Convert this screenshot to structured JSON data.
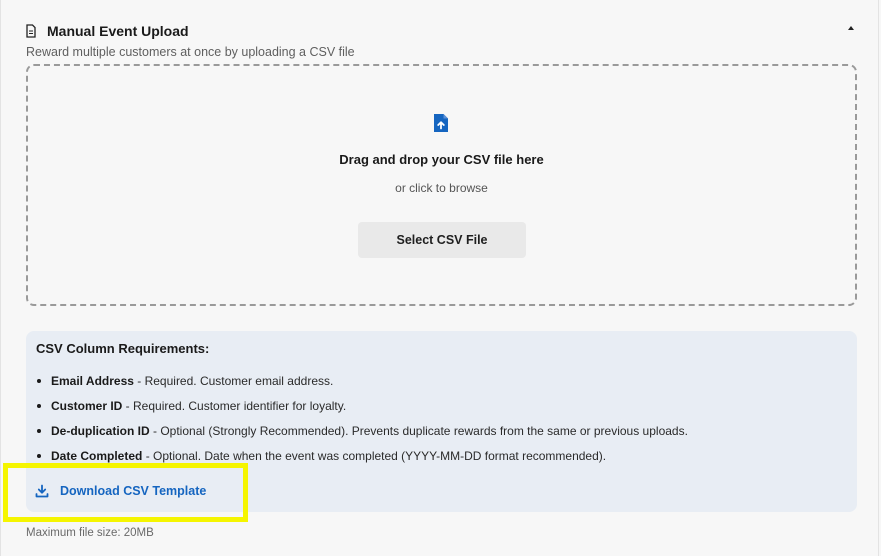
{
  "header": {
    "title": "Manual Event Upload",
    "subtitle": "Reward multiple customers at once by uploading a CSV file"
  },
  "dropzone": {
    "title": "Drag and drop your CSV file here",
    "subtitle": "or click to browse",
    "button_label": "Select CSV File"
  },
  "requirements": {
    "title": "CSV Column Requirements:",
    "items": [
      {
        "name": "Email Address",
        "desc": " - Required. Customer email address."
      },
      {
        "name": "Customer ID",
        "desc": " - Required. Customer identifier for loyalty."
      },
      {
        "name": "De-duplication ID",
        "desc": " - Optional (Strongly Recommended). Prevents duplicate rewards from the same or previous uploads."
      },
      {
        "name": "Date Completed",
        "desc": " - Optional. Date when the event was completed (YYYY-MM-DD format recommended)."
      }
    ],
    "download_label": "Download CSV Template"
  },
  "footer": {
    "max_size": "Maximum file size: 20MB"
  },
  "icons": {
    "header": "document-icon",
    "collapse": "chevron-up-icon",
    "upload": "file-upload-icon",
    "download": "download-icon"
  },
  "colors": {
    "accent": "#1565c0",
    "highlight": "#f5f500",
    "requirements_bg": "#e8edf4"
  }
}
